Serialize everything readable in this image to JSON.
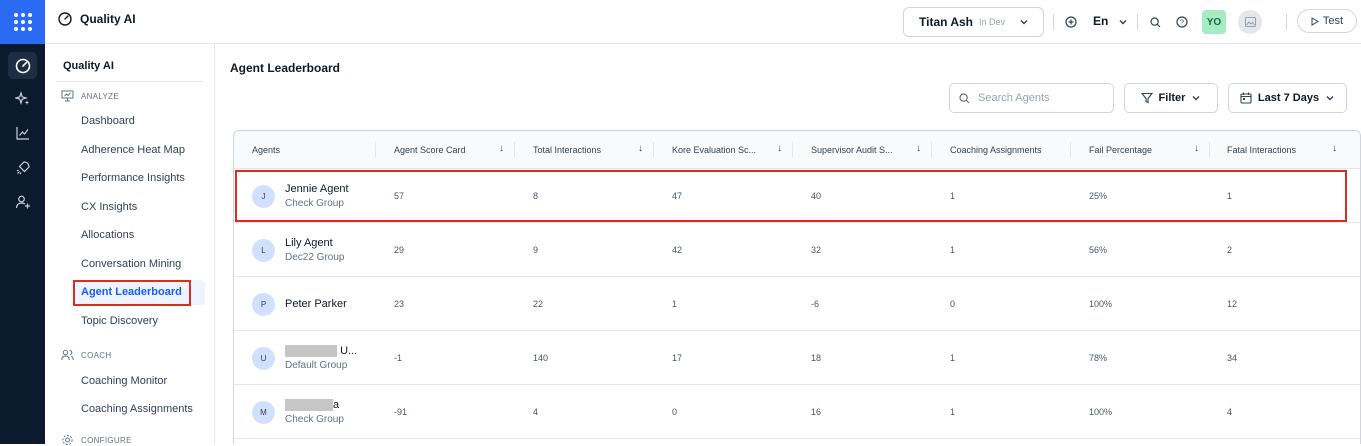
{
  "app": {
    "name": "Quality AI"
  },
  "workspace": {
    "name": "Titan Ash",
    "env": "In Dev"
  },
  "header": {
    "language": "En",
    "user_initials": "YO",
    "test_label": "Test"
  },
  "colors": {
    "accent": "#155eef",
    "rail_bg": "#0c1a2e",
    "app_launcher": "#2b6bf3",
    "highlight": "#d92d20"
  },
  "sidebar": {
    "title": "Quality AI",
    "sections": {
      "analyze": "ANALYZE",
      "coach": "COACH",
      "configure": "CONFIGURE"
    },
    "analyze_items": [
      "Dashboard",
      "Adherence Heat Map",
      "Performance Insights",
      "CX Insights",
      "Allocations",
      "Conversation Mining",
      "Agent Leaderboard",
      "Topic Discovery"
    ],
    "coach_items": [
      "Coaching Monitor",
      "Coaching Assignments"
    ],
    "active_item": "Agent Leaderboard"
  },
  "rail_icons": [
    "gauge-icon",
    "sparkles-icon",
    "chart-line-icon",
    "rocket-icon",
    "user-plus-icon"
  ],
  "page": {
    "title": "Agent Leaderboard",
    "search_placeholder": "Search Agents",
    "filter_label": "Filter",
    "date_range": "Last 7 Days"
  },
  "table": {
    "columns": [
      "Agents",
      "Agent Score Card",
      "Total Interactions",
      "Kore Evaluation Sc...",
      "Supervisor Audit S...",
      "Coaching Assignments",
      "Fail Percentage",
      "Fatal Interactions"
    ],
    "rows": [
      {
        "initial": "J",
        "name": "Jennie Agent",
        "group": "Check Group",
        "score": "57",
        "interactions": "8",
        "kore": "47",
        "supervisor": "40",
        "coaching": "1",
        "fail": "25%",
        "fatal": "1"
      },
      {
        "initial": "L",
        "name": "Lily Agent",
        "group": "Dec22 Group",
        "score": "29",
        "interactions": "9",
        "kore": "42",
        "supervisor": "32",
        "coaching": "1",
        "fail": "56%",
        "fatal": "2"
      },
      {
        "initial": "P",
        "name": "Peter Parker",
        "group": "",
        "score": "23",
        "interactions": "22",
        "kore": "1",
        "supervisor": "-6",
        "coaching": "0",
        "fail": "100%",
        "fatal": "12"
      },
      {
        "initial": "U",
        "name": "U...",
        "group": "Default Group",
        "score": "-1",
        "interactions": "140",
        "kore": "17",
        "supervisor": "18",
        "coaching": "1",
        "fail": "78%",
        "fatal": "34"
      },
      {
        "initial": "M",
        "name": "a",
        "group": "Check Group",
        "score": "-91",
        "interactions": "4",
        "kore": "0",
        "supervisor": "16",
        "coaching": "1",
        "fail": "100%",
        "fatal": "4"
      }
    ]
  }
}
